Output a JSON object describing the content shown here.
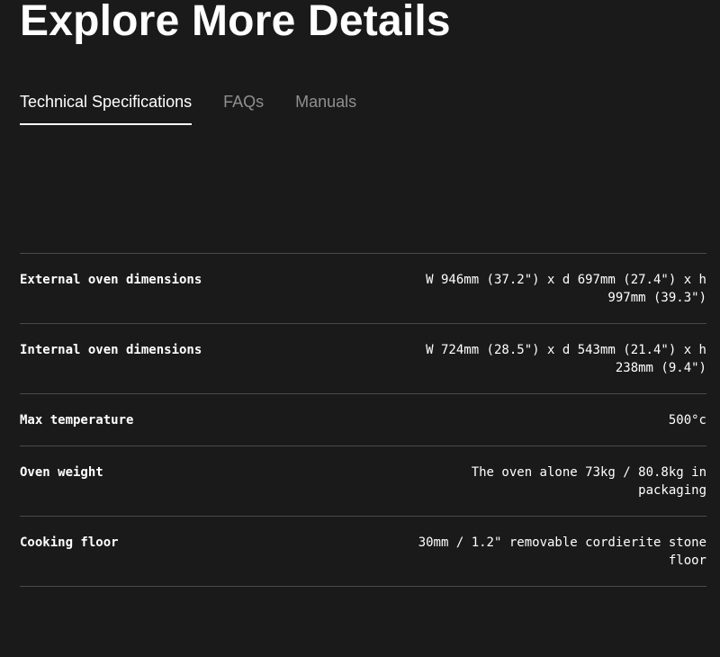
{
  "heading": "Explore More Details",
  "tabs": [
    {
      "label": "Technical Specifications",
      "active": true
    },
    {
      "label": "FAQs",
      "active": false
    },
    {
      "label": "Manuals",
      "active": false
    }
  ],
  "specs": [
    {
      "label": "External oven dimensions",
      "value": "W 946mm (37.2\") x d 697mm (27.4\") x h\n997mm (39.3\")"
    },
    {
      "label": "Internal oven dimensions",
      "value": "W 724mm (28.5\") x d 543mm (21.4\") x h\n238mm (9.4\")"
    },
    {
      "label": "Max temperature",
      "value": "500°c"
    },
    {
      "label": "Oven weight",
      "value": "The oven alone 73kg / 80.8kg in\npackaging"
    },
    {
      "label": "Cooking floor",
      "value": "30mm / 1.2\" removable cordierite stone\nfloor"
    }
  ],
  "colors": {
    "background": "#1a1a1a",
    "text": "#ffffff",
    "inactive_tab": "#8f8f8f",
    "divider": "#4a4a4a"
  }
}
